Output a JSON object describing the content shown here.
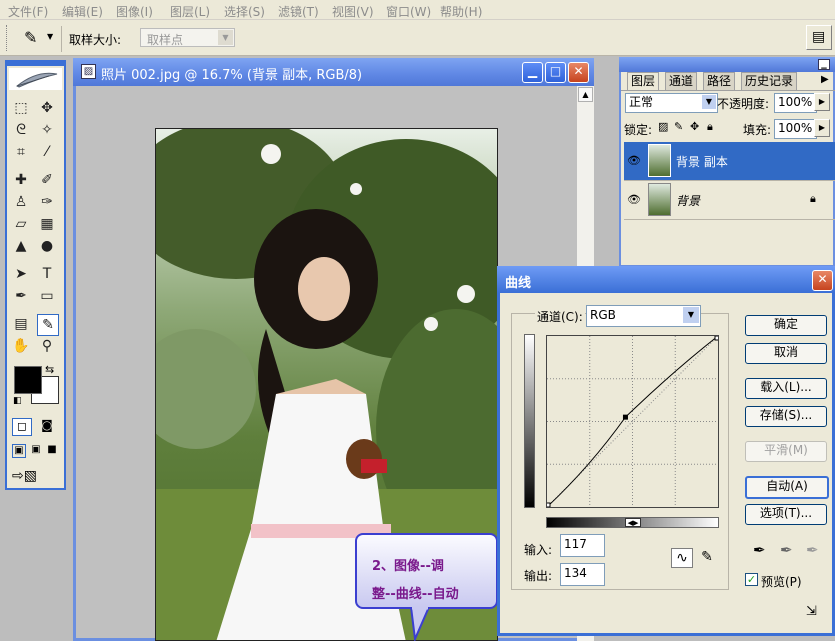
{
  "menu": [
    "文件(F)",
    "编辑(E)",
    "图像(I)",
    "图层(L)",
    "选择(S)",
    "滤镜(T)",
    "视图(V)",
    "窗口(W)",
    "帮助(H)"
  ],
  "options_bar": {
    "sample_size_label": "取样大小:",
    "sample_size_value": "取样点"
  },
  "document": {
    "title": "照片 002.jpg @ 16.7% (背景 副本, RGB/8)"
  },
  "layers_panel": {
    "tabs": [
      "图层",
      "通道",
      "路径",
      "历史记录"
    ],
    "blend_mode": "正常",
    "opacity_label": "不透明度:",
    "opacity_value": "100%",
    "lock_label": "锁定:",
    "fill_label": "填充:",
    "fill_value": "100%",
    "layers": [
      {
        "name": "背景 副本",
        "selected": true
      },
      {
        "name": "背景",
        "selected": false
      }
    ]
  },
  "curves_dialog": {
    "title": "曲线",
    "channel_label": "通道(C):",
    "channel_value": "RGB",
    "input_label": "输入:",
    "input_value": "117",
    "output_label": "输出:",
    "output_value": "134",
    "buttons": {
      "ok": "确定",
      "cancel": "取消",
      "load": "载入(L)...",
      "save": "存储(S)...",
      "smooth": "平滑(M)",
      "auto": "自动(A)",
      "options": "选项(T)..."
    },
    "preview_label": "预览(P)",
    "preview_checked": true
  },
  "callout": {
    "line1": "2、图像--调",
    "line2": "整--曲线--自动"
  },
  "colors": {
    "title_blue": "#3a6fd6",
    "selection": "#316ac5",
    "callout_text": "#7a1a8c"
  }
}
